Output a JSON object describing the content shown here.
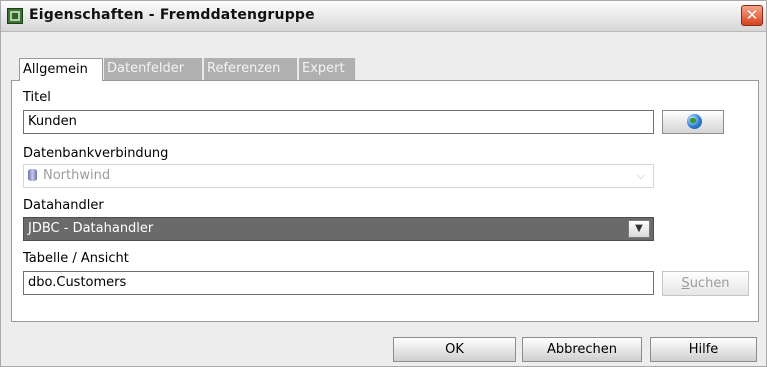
{
  "window": {
    "title": "Eigenschaften - Fremddatengruppe",
    "close_label": "✕"
  },
  "tabs": [
    {
      "label": "Allgemein",
      "active": true
    },
    {
      "label": "Datenfelder",
      "active": false
    },
    {
      "label": "Referenzen",
      "active": false
    },
    {
      "label": "Expert",
      "active": false
    }
  ],
  "form": {
    "title_label": "Titel",
    "title_value": "Kunden",
    "connection_label": "Datenbankverbindung",
    "connection_value": "Northwind",
    "handler_label": "Datahandler",
    "handler_value": "JDBC - Datahandler",
    "table_label": "Tabelle / Ansicht",
    "table_value": "dbo.Customers",
    "search_button_first": "S",
    "search_button_rest": "uchen"
  },
  "icons": {
    "app": "app-icon",
    "globe": "globe-icon",
    "database": "database-icon",
    "dropdown": "chevron-down-icon"
  },
  "footer": {
    "ok_label": "OK",
    "cancel_label": "Abbrechen",
    "help_label": "Hilfe"
  }
}
